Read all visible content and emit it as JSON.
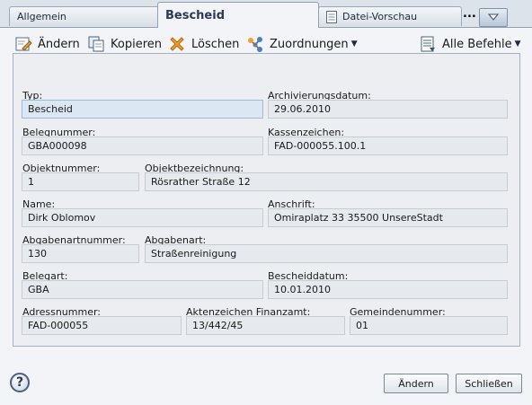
{
  "tabs": [
    {
      "label": "Allgemein"
    },
    {
      "label": "Bescheid"
    },
    {
      "label": "Datei-Vorschau"
    }
  ],
  "tab_overflow": "...",
  "toolbar": {
    "edit_label": "Ändern",
    "copy_label": "Kopieren",
    "delete_label": "Löschen",
    "assign_label": "Zuordnungen",
    "all_commands_label": "Alle Befehle"
  },
  "form": {
    "typ": {
      "label": "Typ:",
      "value": "Bescheid"
    },
    "archivierungsdatum": {
      "label": "Archivierungsdatum:",
      "value": "29.06.2010"
    },
    "belegnummer": {
      "label": "Belegnummer:",
      "value": "GBA000098"
    },
    "kassenzeichen": {
      "label": "Kassenzeichen:",
      "value": "FAD-000055.100.1"
    },
    "objektnummer": {
      "label": "Objektnummer:",
      "value": "1"
    },
    "objektbezeichnung": {
      "label": "Objektbezeichnung:",
      "value": "Rösrather Straße 12"
    },
    "name": {
      "label": "Name:",
      "value": "Dirk Oblomov"
    },
    "anschrift": {
      "label": "Anschrift:",
      "value": "Omiraplatz 33 35500 UnsereStadt"
    },
    "abgabenartnummer": {
      "label": "Abgabenartnummer:",
      "value": "130"
    },
    "abgabenart": {
      "label": "Abgabenart:",
      "value": "Straßenreinigung"
    },
    "belegart": {
      "label": "Belegart:",
      "value": "GBA"
    },
    "bescheiddatum": {
      "label": "Bescheiddatum:",
      "value": "10.01.2010"
    },
    "adressnummer": {
      "label": "Adressnummer:",
      "value": "FAD-000055"
    },
    "aktenzeichen": {
      "label": "Aktenzeichen Finanzamt:",
      "value": "13/442/45"
    },
    "gemeindenummer": {
      "label": "Gemeindenummer:",
      "value": "01"
    }
  },
  "footer": {
    "help_symbol": "?",
    "edit_label": "Ändern",
    "close_label": "Schließen"
  },
  "icons": {
    "edit": "pencil-form-icon",
    "copy": "copy-icon",
    "delete": "x-delete-icon",
    "assign": "connection-icon",
    "all_commands": "list-icon",
    "help": "help-icon"
  },
  "colors": {
    "accent": "#2a3a55",
    "delete": "#e08a1e",
    "field_bg": "#e6e9ed"
  }
}
